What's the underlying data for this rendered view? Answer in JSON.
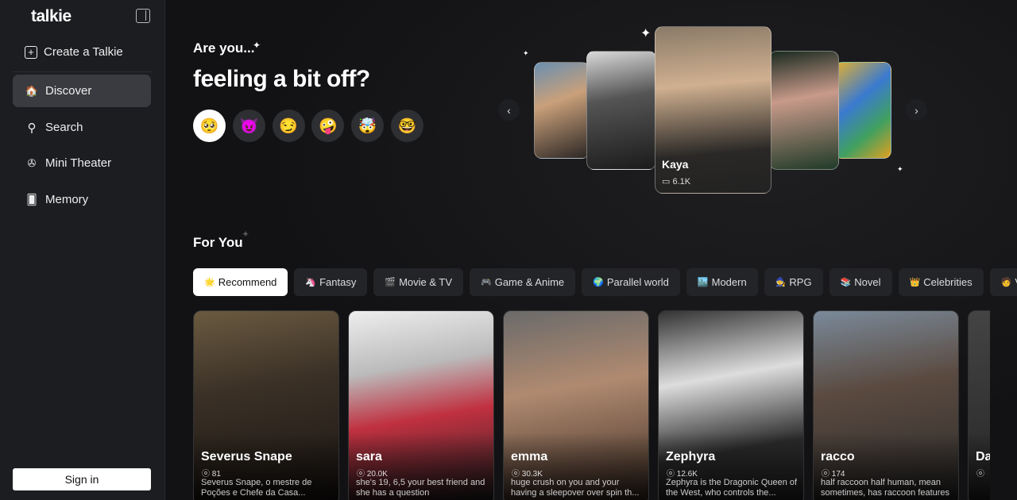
{
  "sidebar": {
    "logo": "talkie",
    "items": [
      {
        "label": "Create a Talkie",
        "icon": "plus-square-icon"
      },
      {
        "label": "Discover",
        "icon": "home-icon"
      },
      {
        "label": "Search",
        "icon": "search-icon"
      },
      {
        "label": "Mini Theater",
        "icon": "film-reel-icon"
      },
      {
        "label": "Memory",
        "icon": "cards-icon"
      }
    ],
    "sign_in": "Sign in"
  },
  "hero": {
    "kicker": "Are you...",
    "title": "feeling a bit off?",
    "moods": [
      "🥺",
      "😈",
      "😏",
      "🤪",
      "🤯",
      "🤓"
    ],
    "featured": {
      "name": "Kaya",
      "count": "6.1K"
    }
  },
  "section": {
    "title": "For You"
  },
  "categories": [
    {
      "emoji": "🌟",
      "label": "Recommend"
    },
    {
      "emoji": "🦄",
      "label": "Fantasy"
    },
    {
      "emoji": "🎬",
      "label": "Movie & TV"
    },
    {
      "emoji": "🎮",
      "label": "Game & Anime"
    },
    {
      "emoji": "🌍",
      "label": "Parallel world"
    },
    {
      "emoji": "🏙️",
      "label": "Modern"
    },
    {
      "emoji": "🧙",
      "label": "RPG"
    },
    {
      "emoji": "📚",
      "label": "Novel"
    },
    {
      "emoji": "👑",
      "label": "Celebrities"
    },
    {
      "emoji": "🧑",
      "label": "Vtuber"
    }
  ],
  "cards": [
    {
      "name": "Severus Snape",
      "count": "81",
      "desc": "Severus Snape, o mestre de Poções e Chefe da Casa..."
    },
    {
      "name": "sara",
      "count": "20.0K",
      "desc": "she's 19, 6,5 your best friend and she has a question"
    },
    {
      "name": "emma",
      "count": "30.3K",
      "desc": "huge crush on you and your having a sleepover over spin th..."
    },
    {
      "name": "Zephyra",
      "count": "12.6K",
      "desc": "Zephyra is the Dragonic Queen of the West, who controls the..."
    },
    {
      "name": "racco",
      "count": "174",
      "desc": "half raccoon half human, mean sometimes, has raccoon features"
    },
    {
      "name": "Da",
      "count": "",
      "desc": ""
    }
  ]
}
